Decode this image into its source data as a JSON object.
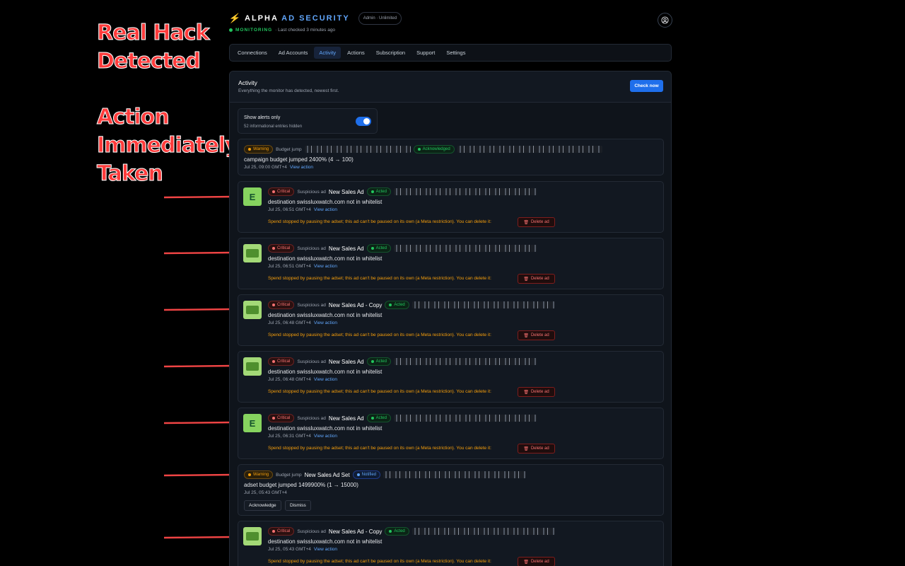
{
  "annotations": {
    "hack_title": [
      "Real Hack",
      "Detected"
    ],
    "action_title": [
      "Action",
      "Immediately",
      "Taken"
    ]
  },
  "header": {
    "brand_part1": "ALPHA",
    "brand_part2": "AD SECURITY",
    "plan": "Admin · Unlimited",
    "status": "MONITORING",
    "last_checked": "· Last checked 3 minutes ago"
  },
  "tabs": [
    "Connections",
    "Ad Accounts",
    "Activity",
    "Actions",
    "Subscription",
    "Support",
    "Settings"
  ],
  "panel": {
    "title": "Activity",
    "subtitle": "Everything the monitor has detected, newest first.",
    "check_button": "Check now",
    "toggle_label": "Show alerts only",
    "toggle_sub": "52 informational entries hidden"
  },
  "items": [
    {
      "severity": "Warning",
      "kind": "Budget jump",
      "name": "",
      "status": "Acknowledged",
      "message": "campaign budget jumped 2400% (4 → 100)",
      "time": "Jul 25, 09:00 GMT+4",
      "link": "View action"
    },
    {
      "severity": "Critical",
      "kind": "Suspicious ad",
      "name": "New Sales Ad",
      "status": "Acted",
      "message": "destination swissluxwatch.com not in whitelist",
      "time": "Jul 25, 06:51 GMT+4",
      "link": "View action",
      "note": "Spend stopped by pausing the adset; this ad can't be paused on its own (a Meta restriction). You can delete it:",
      "delete": "Delete ad",
      "thumb": "E"
    },
    {
      "severity": "Critical",
      "kind": "Suspicious ad",
      "name": "New Sales Ad",
      "status": "Acted",
      "message": "destination swissluxwatch.com not in whitelist",
      "time": "Jul 25, 06:51 GMT+4",
      "link": "View action",
      "note": "Spend stopped by pausing the adset; this ad can't be paused on its own (a Meta restriction). You can delete it:",
      "delete": "Delete ad",
      "thumb": ""
    },
    {
      "severity": "Critical",
      "kind": "Suspicious ad",
      "name": "New Sales Ad - Copy",
      "status": "Acted",
      "message": "destination swissluxwatch.com not in whitelist",
      "time": "Jul 25, 06:48 GMT+4",
      "link": "View action",
      "note": "Spend stopped by pausing the adset; this ad can't be paused on its own (a Meta restriction). You can delete it:",
      "delete": "Delete ad",
      "thumb": ""
    },
    {
      "severity": "Critical",
      "kind": "Suspicious ad",
      "name": "New Sales Ad",
      "status": "Acted",
      "message": "destination swissluxwatch.com not in whitelist",
      "time": "Jul 25, 06:48 GMT+4",
      "link": "View action",
      "note": "Spend stopped by pausing the adset; this ad can't be paused on its own (a Meta restriction). You can delete it:",
      "delete": "Delete ad",
      "thumb": ""
    },
    {
      "severity": "Critical",
      "kind": "Suspicious ad",
      "name": "New Sales Ad",
      "status": "Acted",
      "message": "destination swissluxwatch.com not in whitelist",
      "time": "Jul 25, 06:31 GMT+4",
      "link": "View action",
      "note": "Spend stopped by pausing the adset; this ad can't be paused on its own (a Meta restriction). You can delete it:",
      "delete": "Delete ad",
      "thumb": "E"
    },
    {
      "severity": "Warning",
      "kind": "Budget jump",
      "name": "New Sales Ad Set",
      "status": "Notified",
      "message": "adset budget jumped 1499900% (1 → 15000)",
      "time": "Jul 25, 05:43 GMT+4",
      "ack_button": "Acknowledge",
      "dismiss_button": "Dismiss"
    },
    {
      "severity": "Critical",
      "kind": "Suspicious ad",
      "name": "New Sales Ad - Copy",
      "status": "Acted",
      "message": "destination swissluxwatch.com not in whitelist",
      "time": "Jul 25, 05:43 GMT+4",
      "link": "View action",
      "note": "Spend stopped by pausing the adset; this ad can't be paused on its own (a Meta restriction). You can delete it:",
      "delete": "Delete ad",
      "thumb": ""
    }
  ],
  "colors": {
    "background": "#000000",
    "accent": "#1f6feb",
    "critical": "#f87171",
    "warning": "#f59e0b",
    "success": "#22c55e",
    "annotation": "#ff3b3b"
  }
}
